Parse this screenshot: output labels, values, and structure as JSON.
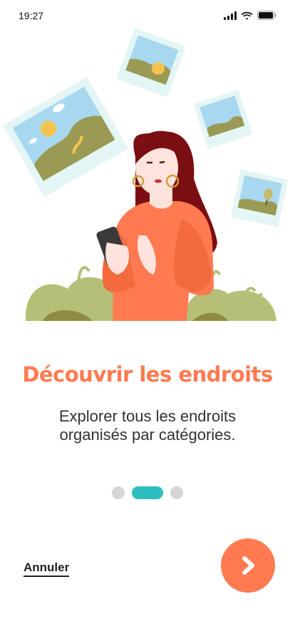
{
  "status_bar": {
    "time": "19:27"
  },
  "onboarding": {
    "title": "Découvrir les endroits",
    "subtitle_line1": "Explorer tous les endroits",
    "subtitle_line2": "organisés par catégories.",
    "pager": {
      "total": 3,
      "active_index": 1
    },
    "cancel_label": "Annuler"
  },
  "colors": {
    "accent": "#ff7a50",
    "pager_active": "#2dbfbf",
    "pager_inactive": "#d6d6d6"
  },
  "icons": {
    "signal": "cellular-signal-icon",
    "wifi": "wifi-icon",
    "battery": "battery-icon",
    "next": "chevron-right-icon"
  }
}
